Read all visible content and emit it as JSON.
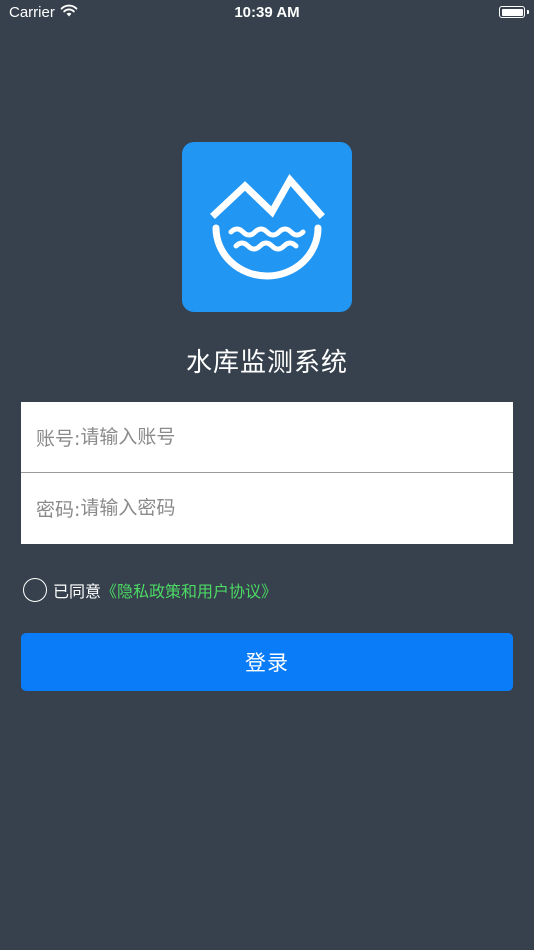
{
  "status_bar": {
    "carrier": "Carrier",
    "time": "10:39 AM",
    "battery_level": 1.0
  },
  "logo": {
    "icon": "reservoir-mountain-water-icon",
    "background_color": "#2196f3"
  },
  "app": {
    "title": "水库监测系统"
  },
  "form": {
    "account": {
      "label": "账号:",
      "placeholder": "请输入账号",
      "value": ""
    },
    "password": {
      "label": "密码:",
      "placeholder": "请输入密码",
      "value": ""
    }
  },
  "agreement": {
    "checked": false,
    "prefix": "已同意",
    "link": "《隐私政策和用户协议》",
    "link_color": "#4cd964"
  },
  "login_button": {
    "label": "登录",
    "color": "#0a7cf7"
  },
  "colors": {
    "background": "#36414d"
  }
}
